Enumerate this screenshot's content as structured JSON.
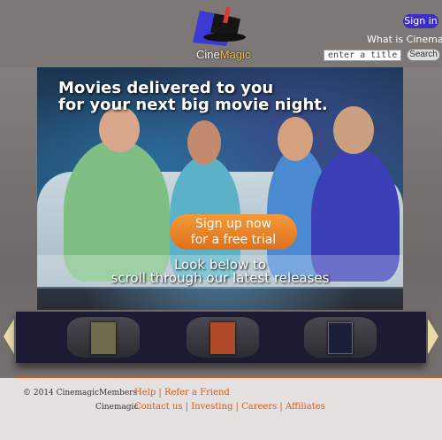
{
  "header": {
    "logo_text_a": "Cine",
    "logo_text_b": "Magic",
    "signin_label": "Sign in",
    "what_is_label": "What is Cinemagic?",
    "search": {
      "placeholder": "enter a title...",
      "value": "enter a title...",
      "button_label": "Search"
    }
  },
  "hero": {
    "headline_line1": "Movies delivered to you",
    "headline_line2": "for your next big movie night.",
    "cta_line1": "Sign up now",
    "cta_line2": "for a free trial",
    "scroll_line1": "Look below to",
    "scroll_line2": "scroll through our latest releases"
  },
  "carousel": {
    "items": [
      {
        "icon": "movie-poster-1",
        "color": "#6e6a4e"
      },
      {
        "icon": "movie-poster-2",
        "color": "#b04a2a"
      },
      {
        "icon": "movie-poster-3",
        "color": "#1a1f3a"
      }
    ]
  },
  "footer": {
    "copyright": "© 2014 Cinemagic",
    "members_label": "Members",
    "members_links": [
      "Help",
      "Refer a Friend"
    ],
    "cinemagic_label": "Cinemagic",
    "cinemagic_links": [
      "Contact us",
      "Investing",
      "Careers",
      "Affiliates"
    ]
  },
  "colors": {
    "accent": "#d8581a",
    "signin": "#3c2fc9",
    "cta": "#f0851f"
  }
}
